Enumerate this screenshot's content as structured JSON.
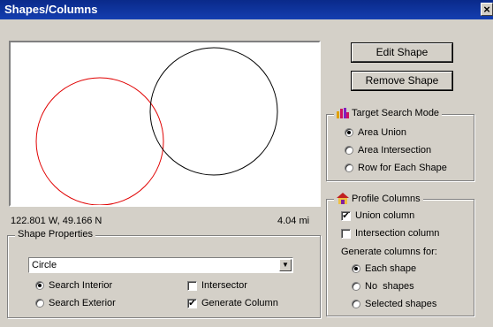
{
  "window": {
    "title": "Shapes/Columns",
    "close_label": "×"
  },
  "map": {
    "coordinates": "122.801 W,  49.166 N",
    "scale": "4.04 mi",
    "shape_colors": {
      "red_circle": "#e00000",
      "black_circle": "#000000"
    }
  },
  "buttons": {
    "edit_shape": "Edit Shape",
    "remove_shape": "Remove Shape"
  },
  "shape_properties": {
    "title": "Shape Properties",
    "shape_type": "Circle",
    "search_interior": "Search Interior",
    "search_exterior": "Search Exterior",
    "search_selected": "interior",
    "intersector": {
      "label": "Intersector",
      "checked": false
    },
    "generate_column": {
      "label": "Generate Column",
      "checked": true
    }
  },
  "target_search_mode": {
    "title": "Target Search Mode",
    "icon": "bar-chart-icon",
    "options": [
      "Area Union",
      "Area Intersection",
      "Row for Each Shape"
    ],
    "selected": "Area Union"
  },
  "profile_columns": {
    "title": "Profile Columns",
    "icon": "house-icon",
    "union_column": {
      "label": "Union column",
      "checked": true
    },
    "intersection_column": {
      "label": "Intersection column",
      "checked": false
    },
    "generate_label": "Generate columns for:",
    "options": [
      "Each shape",
      "No  shapes",
      "Selected shapes"
    ],
    "selected": "Each shape"
  }
}
